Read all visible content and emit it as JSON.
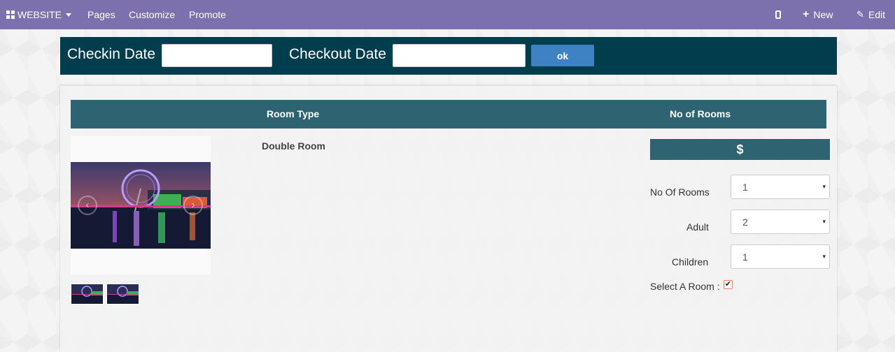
{
  "navbar": {
    "website_label": "WEBSITE",
    "menu": [
      "Pages",
      "Customize",
      "Promote"
    ],
    "new_label": "New",
    "edit_label": "Edit",
    "bg_color": "#7c71ad"
  },
  "search": {
    "checkin_label": "Checkin Date",
    "checkin_value": "",
    "checkout_label": "Checkout Date",
    "checkout_value": "",
    "ok_label": "ok",
    "bar_color": "#003d4d",
    "button_color": "#3f82c4"
  },
  "table": {
    "headers": [
      "Room Type",
      "No of Rooms"
    ],
    "header_color": "#2e6472"
  },
  "room": {
    "name": "Double Room",
    "price_symbol": "$",
    "fields": [
      {
        "label": "No Of Rooms",
        "value": "1"
      },
      {
        "label": "Adult",
        "value": "2"
      },
      {
        "label": "Children",
        "value": "1"
      }
    ],
    "select_label": "Select A Room :",
    "selected": true,
    "check_mark": "✔"
  },
  "icons": {
    "apps": "grid-icon",
    "mobile": "mobile-icon",
    "plus": "+",
    "pencil": "✎",
    "prev": "‹",
    "next": "›",
    "caret": "▾"
  }
}
